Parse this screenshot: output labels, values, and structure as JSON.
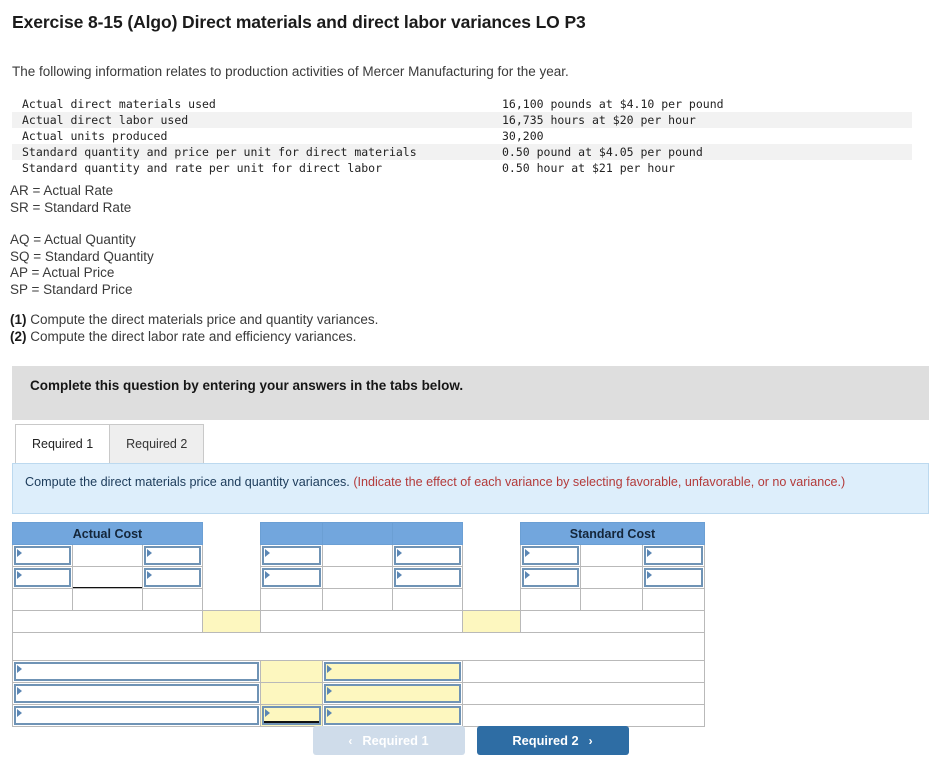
{
  "title": "Exercise 8-15 (Algo) Direct materials and direct labor variances LO P3",
  "intro": "The following information relates to production activities of Mercer Manufacturing for the year.",
  "facts": {
    "rows": [
      {
        "label": "Actual direct materials used",
        "value": "16,100 pounds at $4.10 per pound"
      },
      {
        "label": "Actual direct labor used",
        "value": "16,735 hours at $20 per hour"
      },
      {
        "label": "Actual units produced",
        "value": "30,200"
      },
      {
        "label": "Standard quantity and price per unit for direct materials",
        "value": "0.50 pound at $4.05 per pound"
      },
      {
        "label": "Standard quantity and rate per unit for direct labor",
        "value": "0.50 hour at $21 per hour"
      }
    ]
  },
  "legend": {
    "group1": [
      "AR = Actual Rate",
      "SR = Standard Rate"
    ],
    "group2": [
      "AQ = Actual Quantity",
      "SQ = Standard Quantity",
      "AP = Actual Price",
      "SP = Standard Price"
    ],
    "requirements": [
      {
        "num": "(1)",
        "text": " Compute the direct materials price and quantity variances."
      },
      {
        "num": "(2)",
        "text": " Compute the direct labor rate and efficiency variances."
      }
    ]
  },
  "gray_bar": {
    "text": "Complete this question by entering your answers in the tabs below."
  },
  "tabs": [
    {
      "label": "Required 1",
      "active": true
    },
    {
      "label": "Required 2",
      "active": false
    }
  ],
  "requirement_panel": {
    "main": "Compute the direct materials price and quantity variances. ",
    "hint": "(Indicate the effect of each variance by selecting favorable, unfavorable, or no variance.)"
  },
  "answer_grid": {
    "headers": {
      "actual_cost": "Actual Cost",
      "standard_cost": "Standard Cost"
    },
    "cells": {
      "r1c1": "",
      "r1c2": "",
      "r1c3": "",
      "r2c1": "",
      "r2c2": "",
      "r2c3": "",
      "m1c1": "",
      "m1c2": "",
      "m1c3": "",
      "m2c1": "",
      "m2c2": "",
      "m2c3": "",
      "s1c1": "",
      "s1c2": "",
      "s1c3": "",
      "s2c1": "",
      "s2c2": "",
      "s2c3": "",
      "v1label": "",
      "v1amt": "",
      "v1effect": "",
      "v2label": "",
      "v2amt": "",
      "v2effect": "",
      "v3label": "",
      "v3amt": "",
      "v3effect": ""
    }
  },
  "footer": {
    "prev_label": "Required 1",
    "next_label": "Required 2",
    "prev_chevron": "‹",
    "next_chevron": "›"
  },
  "colors": {
    "header_blue": "#72a6dd",
    "panel_blue": "#ddeefb",
    "hint_red": "#b33a3a",
    "input_yellow": "#fdf7bf",
    "primary_button": "#2e6da4",
    "disabled_button": "#cfdcea",
    "gray_bar": "#dedede"
  }
}
